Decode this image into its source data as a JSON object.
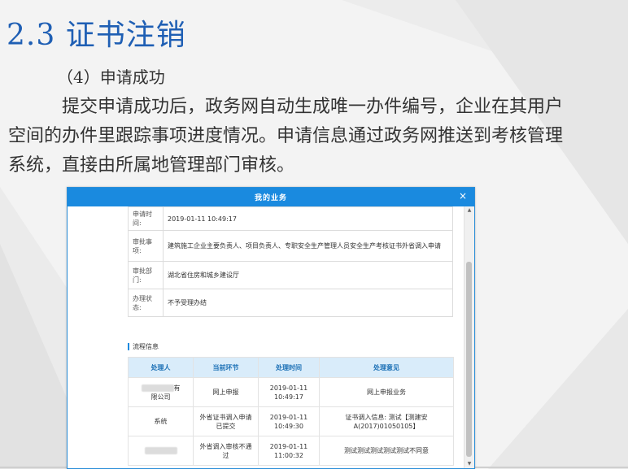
{
  "slide": {
    "title": "2.3 证书注销",
    "subtitle": "（4）申请成功",
    "paragraph": "提交申请成功后，政务网自动生成唯一办件编号，企业在其用户空间的办件里跟踪事项进度情况。申请信息通过政务网推送到考核管理系统，直接由所属地管理部门审核。"
  },
  "dialog": {
    "title": "我的业务",
    "close_glyph": "×",
    "info": [
      {
        "label": "申请时间:",
        "value": "2019-01-11 10:49:17"
      },
      {
        "label": "审批事项:",
        "value": "建筑施工企业主要负责人、项目负责人、专职安全生产管理人员安全生产考核证书外省调入申请"
      },
      {
        "label": "审批部门:",
        "value": "湖北省住房和城乡建设厅"
      },
      {
        "label": "办理状态:",
        "value": "不予受理办结"
      }
    ],
    "flow_title": "流程信息",
    "flow_columns": [
      "处理人",
      "当前环节",
      "处理时间",
      "处理意见"
    ],
    "flow_rows": [
      {
        "handler_suffix": "有",
        "handler_line2": "限公司",
        "step": "网上申报",
        "time_date": "2019-01-11",
        "time_clock": "10:49:17",
        "opinion": "网上申报业务"
      },
      {
        "handler": "系统",
        "step": "外省证书调入申请已提交",
        "time_date": "2019-01-11",
        "time_clock": "10:49:30",
        "opinion": "证书调入信息: 测试【测建安A(2017)01050105】"
      },
      {
        "handler": "",
        "step": "外省调入审核不通过",
        "time_date": "2019-01-11",
        "time_clock": "11:00:32",
        "opinion": "测试测试测试测试测试不同意"
      }
    ]
  },
  "colors": {
    "title_blue": "#1f5fb4",
    "dialog_header": "#1a8adf",
    "table_header_bg": "#d9ecfa"
  }
}
